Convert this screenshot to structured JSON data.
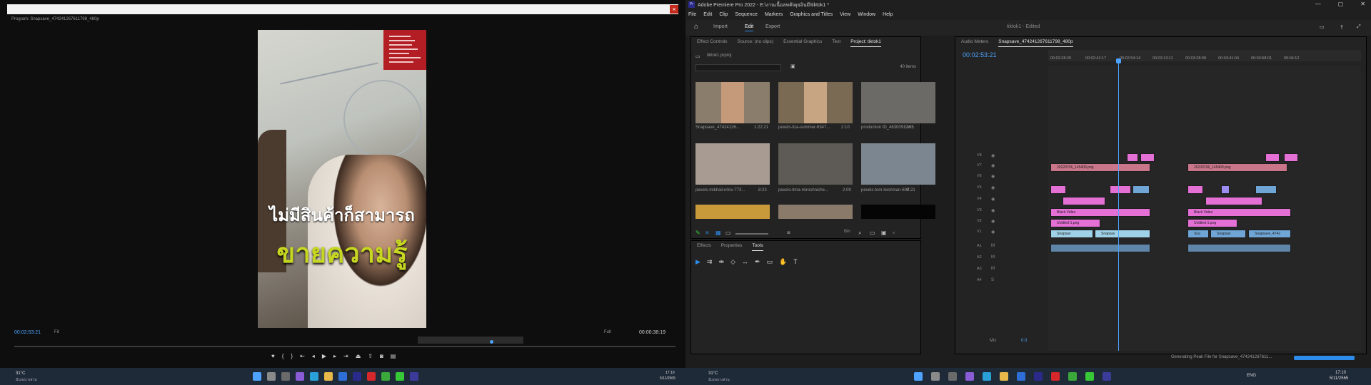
{
  "program_monitor": {
    "title": "Program: Snapsave_474241267611798_480p",
    "caption_line1": "ไม่มีสินค้าก็สามารถ",
    "caption_line2": "ขายความรู้",
    "timecode_current": "00:02:53:21",
    "fit_label": "Fit",
    "quality_label": "Full",
    "timecode_duration": "00:00:38:19"
  },
  "premiere": {
    "app_title": "Adobe Premiere Pro 2022 - E:\\งานเนื้อลหคิ\\คุยอินมี\\tiktok1 *",
    "logo_text": "Pr",
    "menu": [
      "File",
      "Edit",
      "Clip",
      "Sequence",
      "Markers",
      "Graphics and Titles",
      "View",
      "Window",
      "Help"
    ],
    "nav": {
      "home": "⌂",
      "import": "Import",
      "edit": "Edit",
      "export": "Export"
    },
    "doc_title": "tiktok1 - Edited",
    "project_panel": {
      "tabs": [
        "Effect Controls",
        "Source: (no clips)",
        "Essential Graphics",
        "Text",
        "Project: tiktok1"
      ],
      "project_file": "tiktok1.prproj",
      "item_count": "40 items",
      "items": [
        {
          "name": "Snapsave_47424126...",
          "duration": "1:22:21"
        },
        {
          "name": "pexels-liza-summer-6347...",
          "duration": "2:10"
        },
        {
          "name": "production ID_4630091.m...",
          "duration": "9:05"
        },
        {
          "name": "pexels-mikhail-nilov-773...",
          "duration": "8:23"
        },
        {
          "name": "pexels-tima-miroshniche...",
          "duration": "2:09"
        },
        {
          "name": "pexels-tom-leishman-697...",
          "duration": "8:21"
        }
      ],
      "bin_label": "Bin"
    },
    "tools_panel": {
      "tabs": [
        "Effects",
        "Properties",
        "Tools"
      ]
    },
    "timeline": {
      "tabs": [
        "Audio Meters",
        "Snapsave_474241267611798_480p"
      ],
      "timecode": "00:02:53:21",
      "ticks": [
        "00:02:28:20",
        "00:02:41:17",
        "00:02:54:14",
        "00:03:13:11",
        "00:03:28:08",
        "00:03:41:04",
        "00:03:58:01",
        "00:04:12"
      ],
      "tracks": [
        "V8",
        "V7",
        "V6",
        "V5",
        "V4",
        "V3",
        "V2",
        "V1",
        "A1",
        "A2",
        "A3",
        "A4"
      ],
      "mix_label": "Mix",
      "mix_value": "0.0",
      "clip_labels": {
        "png_a": "20220706_145409.png",
        "png_b": "20220706_145409.png",
        "black_a": "Black Video",
        "black_b": "Black Video",
        "untitled_a": "Untitled-1.png",
        "untitled_b": "Untitled-1.png",
        "snap_a": "Snapsav",
        "snap_b": "Snapsav",
        "snap_c": "Sna",
        "snap_d": "Snapsav",
        "snap_e": "Snapsave_4742"
      },
      "track_buttons": {
        "mute": "M",
        "solo": "S"
      }
    },
    "status_text": "Generating Peak File for Snapsave_474241267611..."
  },
  "taskbar_left": {
    "temp": "31°C",
    "weather": "มีเมฆบางส่วน",
    "time": "17:10",
    "date": "5/11/2565"
  },
  "taskbar_right": {
    "temp": "31°C",
    "weather": "มีเมฆบางส่วน",
    "lang": "ENG",
    "time": "17:10",
    "date": "5/11/2565"
  }
}
